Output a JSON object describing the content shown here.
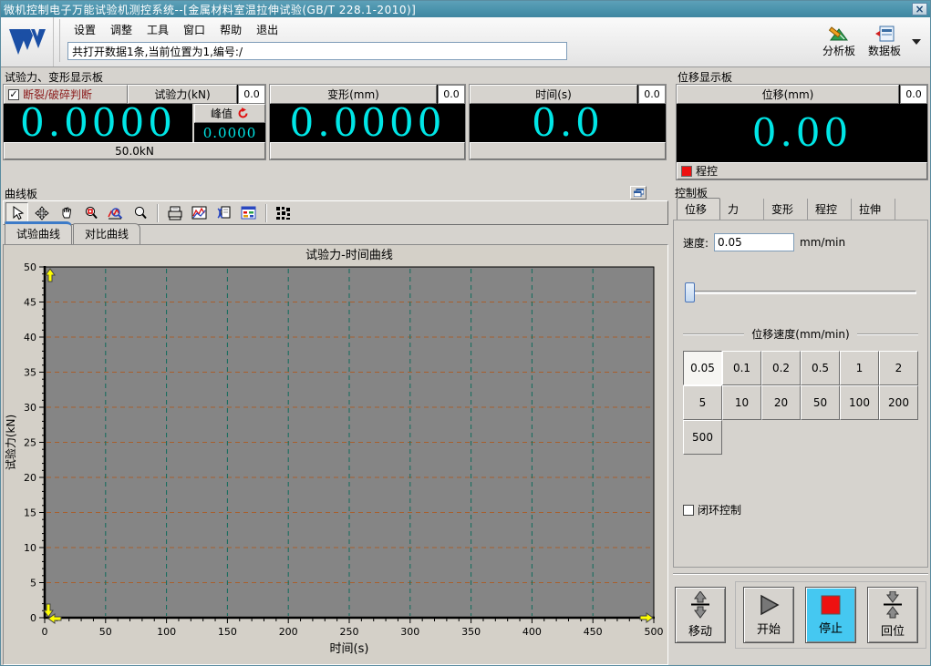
{
  "title_bar": {
    "title": "微机控制电子万能试验机测控系统--[金属材料室温拉伸试验(GB/T 228.1-2010)]",
    "close_glyph": "×"
  },
  "menu": {
    "items": [
      "设置",
      "调整",
      "工具",
      "窗口",
      "帮助",
      "退出"
    ],
    "status": "共打开数据1条,当前位置为1,编号:/",
    "analysis_label": "分析板",
    "data_label": "数据板"
  },
  "force_panel": {
    "header": "试验力、变形显示板",
    "break_check_label": "断裂/破碎判断",
    "break_checked": "✓",
    "force": {
      "title": "试验力(kN)",
      "aux": "0.0",
      "value": "0.0000",
      "peak_label": "峰值",
      "peak_value": "0.0000",
      "range": "50.0kN"
    },
    "deform": {
      "title": "变形(mm)",
      "aux": "0.0",
      "value": "0.0000"
    },
    "time": {
      "title": "时间(s)",
      "aux": "0.0",
      "value": "0.0"
    }
  },
  "disp_panel": {
    "header": "位移显示板",
    "title": "位移(mm)",
    "aux": "0.0",
    "value": "0.00",
    "mode_label": "程控"
  },
  "curve_panel": {
    "header": "曲线板",
    "tabs": [
      "试验曲线",
      "对比曲线"
    ],
    "toolbar_icons": [
      "select-cursor",
      "move-cross",
      "pan-hand",
      "zoom-region",
      "zoom-curve",
      "zoom-out",
      "print",
      "curve-style",
      "copy-curve",
      "data-table",
      "pattern-settings"
    ]
  },
  "control_panel": {
    "header": "控制板",
    "tabs": [
      "位移",
      "力",
      "变形",
      "程控",
      "拉伸"
    ],
    "speed_label": "速度:",
    "speed_value": "0.05",
    "speed_unit": "mm/min",
    "group_label": "位移速度(mm/min)",
    "speed_buttons": [
      "0.05",
      "0.1",
      "0.2",
      "0.5",
      "1",
      "2",
      "5",
      "10",
      "20",
      "50",
      "100",
      "200",
      "500"
    ],
    "selected_speed": "0.05",
    "closed_loop_label": "闭环控制",
    "buttons": {
      "move": "移动",
      "start": "开始",
      "stop": "停止",
      "home": "回位"
    }
  },
  "colors": {
    "titlebar": "#4a93ac",
    "display_bg": "#000000",
    "display_text": "#00e6e6",
    "break_label": "#8b1a1a",
    "stop_active_bg": "#45c8f1",
    "stop_red": "#ee1111",
    "tab_accent": "#3d7bc8",
    "marker_yellow": "#ffff00"
  },
  "chart_data": {
    "type": "line",
    "title": "试验力-时间曲线",
    "xlabel": "时间(s)",
    "ylabel": "试验力(kN)",
    "xlim": [
      0,
      500
    ],
    "ylim": [
      0,
      50
    ],
    "xtick_step": 50,
    "ytick_step": 5,
    "x_minor_step": 10,
    "y_minor_step": 1,
    "grid": true,
    "legend": "none",
    "series": [],
    "plot_bg": "#858585",
    "hgrid_color": "#a85f2d",
    "vgrid_color": "#0f6b5c"
  }
}
